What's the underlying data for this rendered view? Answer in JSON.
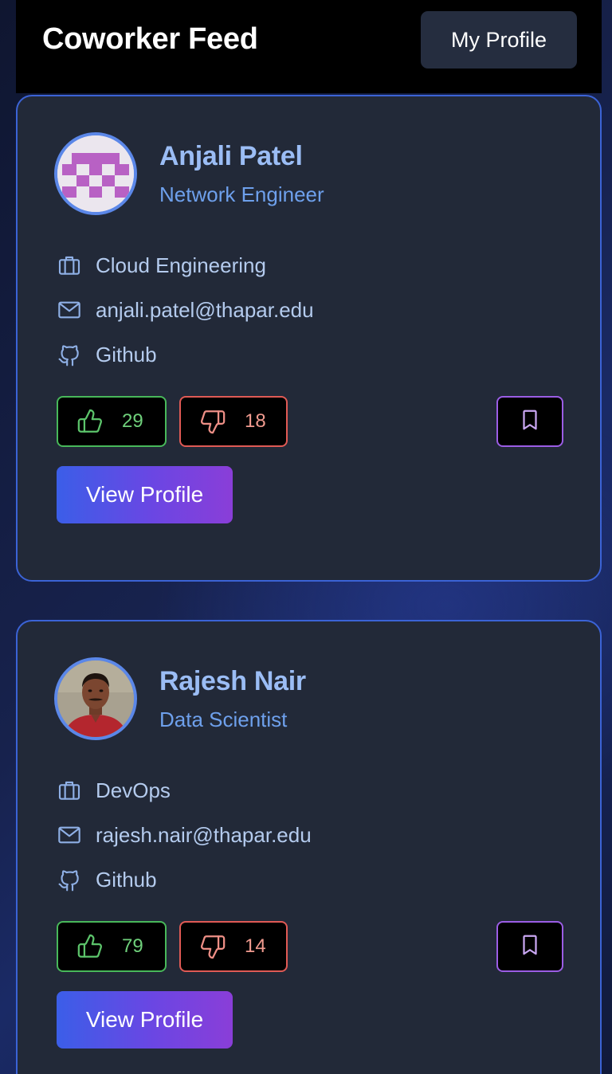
{
  "header": {
    "title": "Coworker Feed",
    "my_profile_label": "My Profile"
  },
  "cards": [
    {
      "name": "Anjali Patel",
      "role": "Network Engineer",
      "department": "Cloud Engineering",
      "email": "anjali.patel@thapar.edu",
      "github_label": "Github",
      "likes": "29",
      "dislikes": "18",
      "view_profile_label": "View Profile",
      "avatar": "identicon"
    },
    {
      "name": "Rajesh Nair",
      "role": "Data Scientist",
      "department": "DevOps",
      "email": "rajesh.nair@thapar.edu",
      "github_label": "Github",
      "likes": "79",
      "dislikes": "14",
      "view_profile_label": "View Profile",
      "avatar": "photo"
    }
  ],
  "icons": {
    "department": "briefcase-icon",
    "email": "mail-icon",
    "github": "github-icon",
    "like": "thumbs-up-icon",
    "dislike": "thumbs-down-icon",
    "bookmark": "bookmark-icon"
  },
  "colors": {
    "accent_blue": "#3b63d6",
    "name": "#9bbdf5",
    "role": "#6ea0ec",
    "like": "#48b85a",
    "dislike": "#e05a55",
    "bookmark": "#9b5de5"
  }
}
